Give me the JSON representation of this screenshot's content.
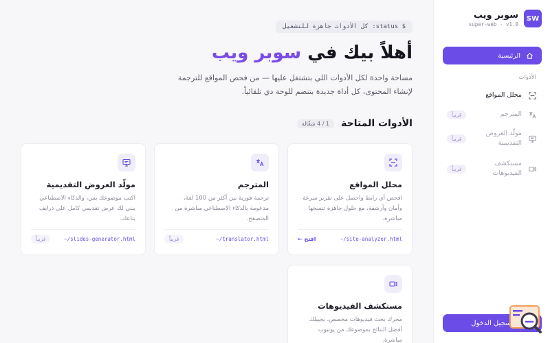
{
  "app": {
    "name": "سوبر ويب",
    "logo_text": "SW",
    "version": "super-web · v1.0"
  },
  "sidebar": {
    "home_label": "الرئيسية",
    "section_label": "الأدوات",
    "items": [
      {
        "label": "محلل المواقع",
        "icon": "scan-icon",
        "soon": ""
      },
      {
        "label": "المترجم",
        "icon": "translate-icon",
        "soon": "قريباً"
      },
      {
        "label": "مولّد العروض التقديمية",
        "icon": "presentation-icon",
        "soon": "قريباً"
      },
      {
        "label": "مستكشف الفيديوهات",
        "icon": "video-icon",
        "soon": "قريباً"
      }
    ],
    "login_label": "تسجيل الدخول"
  },
  "hero": {
    "status": "كل الأدوات جاهزة للتشغيل :status $",
    "title_part1": "أهلاً بيك في",
    "title_accent": "سوبر ويب",
    "description": "مساحة واحدة لكل الأدوات اللي بتشتغل عليها — من فحص المواقع للترجمة لإنشاء المحتوى، كل أداة جديدة بتنضم للوحة دي تلقائياً."
  },
  "tools": {
    "title": "الأدوات المتاحة",
    "count": "1 / 4 شغّالة",
    "cards": [
      {
        "title": "محلل المواقع",
        "desc": "افحص أي رابط واحصل على تقرير سرعة وأمان وأرشفة، مع حلول جاهزة تنسخها مباشرة.",
        "file": "~/site-analyzer.html",
        "action": "افتح ←",
        "icon": "scan-icon"
      },
      {
        "title": "المترجم",
        "desc": "ترجمة فورية بين أكثر من 100 لغة، مدعومة بالذكاء الاصطناعي مباشرة من المتصفح.",
        "file": "~/translator.html",
        "action": "قريباً",
        "icon": "translate-icon"
      },
      {
        "title": "مولّد العروض التقديمية",
        "desc": "اكتب موضوعك بس، والذكاء الاصطناعي يبني لك عرض تقديمي كامل على درايف يتاعك.",
        "file": "~/slides-generator.html",
        "action": "قريباً",
        "icon": "presentation-icon"
      },
      {
        "title": "مستكشف الفيديوهات",
        "desc": "محرك بحث فيديوهات مخصص، يجيبلك أفضل النتائج بموضوعك من يوتيوب مباشرة.",
        "file": "",
        "action": "",
        "icon": "video-icon"
      }
    ]
  },
  "colors": {
    "accent": "#6b4ce6",
    "title_accent": "#7a4ce6",
    "background": "#f7f7f9"
  }
}
